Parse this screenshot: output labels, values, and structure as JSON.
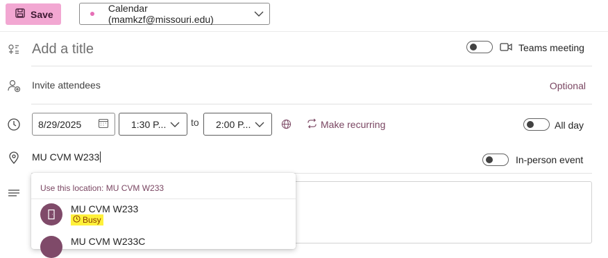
{
  "toolbar": {
    "save_label": "Save",
    "calendar_select": "Calendar (mamkzf@missouri.edu)",
    "calendar_color": "#e66fb6"
  },
  "title": {
    "placeholder": "Add a title"
  },
  "teams": {
    "label": "Teams meeting",
    "enabled": false
  },
  "attendees": {
    "placeholder": "Invite attendees",
    "optional_label": "Optional"
  },
  "time": {
    "date": "8/29/2025",
    "start": "1:30 P...",
    "to_label": "to",
    "end": "2:00 P...",
    "recurring_label": "Make recurring",
    "all_day_label": "All day",
    "all_day_enabled": false
  },
  "location": {
    "value": "MU CVM W233",
    "in_person_label": "In-person event",
    "in_person_enabled": false,
    "suggestions": {
      "header": "Use this location: MU CVM W233",
      "items": [
        {
          "name": "MU CVM W233",
          "status": "Busy"
        },
        {
          "name": "MU CVM W233C"
        }
      ]
    }
  },
  "colors": {
    "accent": "#f2a7d2",
    "brand_text": "#7a4662",
    "avatar": "#7f4a69",
    "busy_highlight": "#fff13a"
  }
}
